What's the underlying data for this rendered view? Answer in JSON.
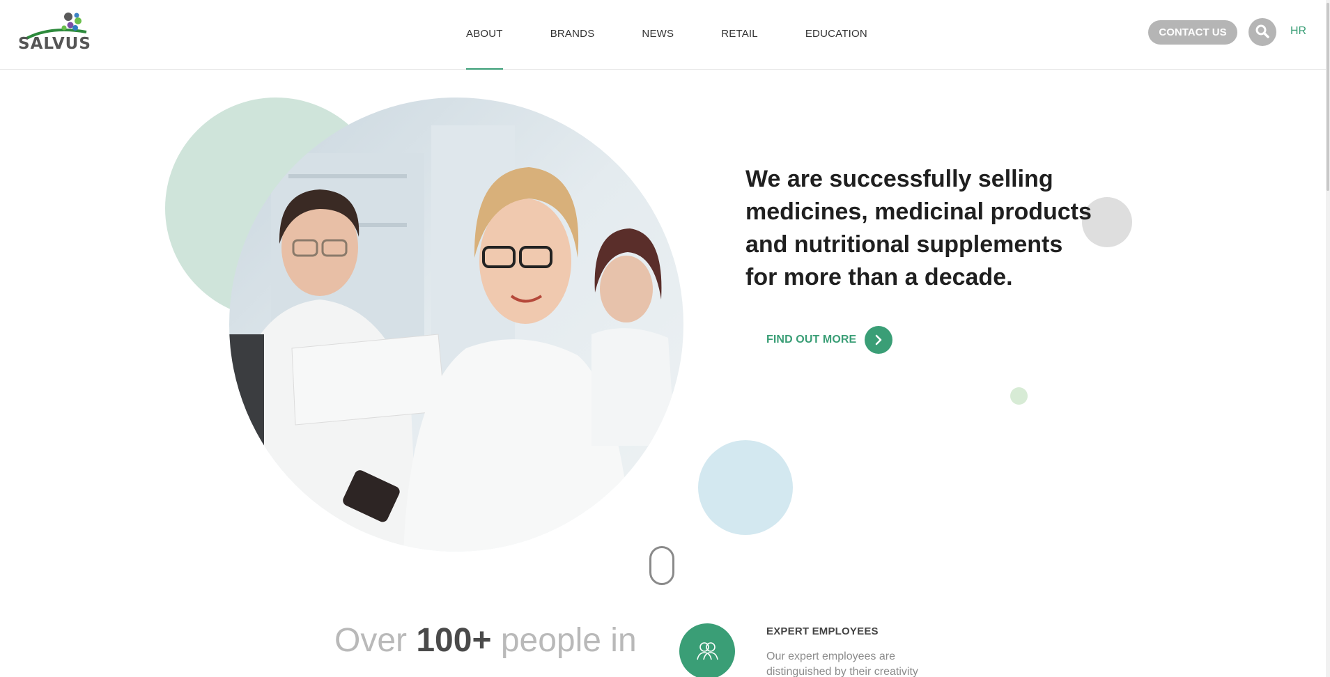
{
  "header": {
    "logo_text": "SALVUS",
    "nav": [
      {
        "label": "ABOUT",
        "active": true
      },
      {
        "label": "BRANDS",
        "active": false
      },
      {
        "label": "NEWS",
        "active": false
      },
      {
        "label": "RETAIL",
        "active": false
      },
      {
        "label": "EDUCATION",
        "active": false
      }
    ],
    "contact_label": "CONTACT US",
    "search_icon": "search-icon",
    "lang_label": "HR"
  },
  "hero": {
    "headline": "We are successfully selling medicines, medicinal products and nutritional supplements for more than a decade.",
    "cta_label": "FIND OUT MORE",
    "cta_icon": "chevron-right-icon",
    "photo_desc": "lab-team-photo"
  },
  "stats": {
    "title_prefix": "Over ",
    "title_number": "100+",
    "title_suffix": " people in",
    "item": {
      "icon": "people-icon",
      "heading": "EXPERT EMPLOYEES",
      "text": "Our expert employees are distinguished by their creativity"
    }
  },
  "colors": {
    "accent": "#3a9e76",
    "button_grey": "#b5b5b5",
    "circle_green": "#cfe4da",
    "circle_blue": "#d3e8f0",
    "circle_grey": "#dedede"
  }
}
